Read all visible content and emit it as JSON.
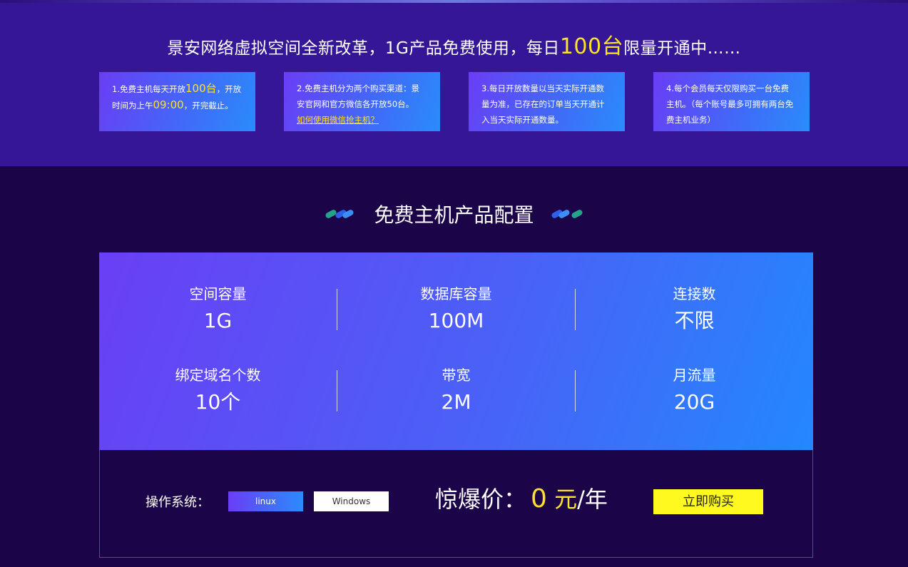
{
  "banner": {
    "headline_pre": "景安网络虚拟空间全新改革，1G产品免费使用，每日",
    "headline_highlight": "100台",
    "headline_post": "限量开通中……"
  },
  "rules": [
    {
      "pre": "1.免费主机每天开放",
      "h1": "100台",
      "mid": "，开放时间为上午",
      "h2": "09:00",
      "post": "，开完截止。"
    },
    {
      "text": "2.免费主机分为两个购买渠道：景安官网和官方微信各开放50台。",
      "link": "如何使用微信抢主机？"
    },
    {
      "text": "3.每日开放数量以当天实际开通数量为准，已存在的订单当天开通计入当天实际开通数量。"
    },
    {
      "text": "4.每个会员每天仅限购买一台免费主机。（每个账号最多可拥有两台免费主机业务）"
    }
  ],
  "section": {
    "title": "免费主机产品配置"
  },
  "specs": [
    {
      "label": "空间容量",
      "value": "1G"
    },
    {
      "label": "数据库容量",
      "value": "100M"
    },
    {
      "label": "连接数",
      "value": "不限"
    },
    {
      "label": "绑定域名个数",
      "value": "10个"
    },
    {
      "label": "带宽",
      "value": "2M"
    },
    {
      "label": "月流量",
      "value": "20G"
    }
  ],
  "purchase": {
    "os_label": "操作系统：",
    "os_options": [
      "linux",
      "Windows"
    ],
    "selected_os": "linux",
    "price_label": "惊爆价：",
    "price_value": "0",
    "price_currency": "元",
    "price_period": "/年",
    "buy_label": "立即购买"
  },
  "colors": {
    "accent_yellow": "#ffe227",
    "buy_button": "#fff91f",
    "page_bg": "#1b0448",
    "banner_bg": "#341696"
  }
}
